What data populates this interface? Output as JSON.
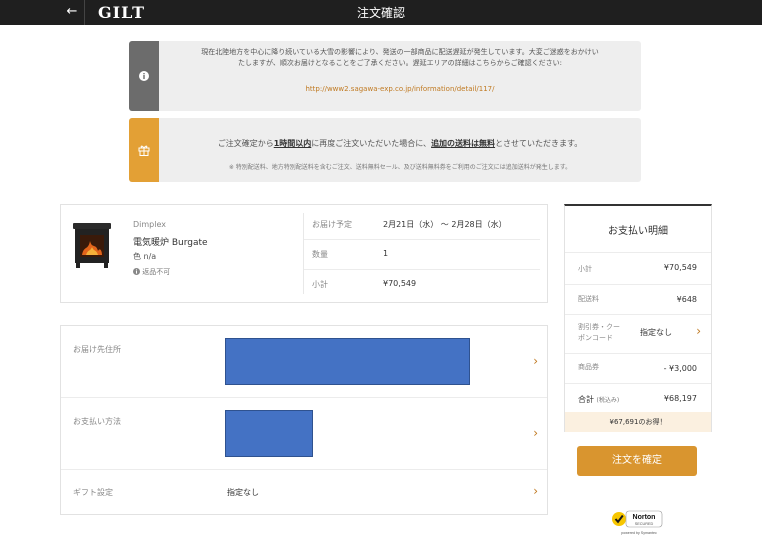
{
  "header": {
    "back_icon": "arrow-left-icon",
    "logo": "GILT",
    "title": "注文確認"
  },
  "notices": {
    "delivery": {
      "icon": "info-icon",
      "line1": "現在北陸地方を中心に降り続いている大雪の影響により、発送の一部商品に配送遅延が発生しています。大変ご迷惑をおかけい",
      "line2": "たしますが、順次お届けとなることをご了承ください。遅延エリアの詳細はこちらからご確認ください:",
      "link": "http://www2.sagawa-exp.co.jp/information/detail/117/"
    },
    "shipping": {
      "icon": "gift-icon",
      "text_a": "ご注文確定から",
      "text_b": "1時間以内",
      "text_c": "に再度ご注文いただいた場合に、",
      "text_d": "追加の送料は無料",
      "text_e": "とさせていただきます。",
      "note": "※ 特別配送料、地方特別配送料を含むご注文、送料無料セール、及び送料無料券をご利用のご注文には追加送料が発生します。"
    }
  },
  "product": {
    "brand": "Dimplex",
    "name": "電気暖炉 Burgate",
    "color": "色 n/a",
    "no_return_icon": "info-icon",
    "no_return": "返品不可",
    "delivery_label": "お届け予定",
    "delivery_value": "2月21日（水） ～ 2月28日（水）",
    "qty_label": "数量",
    "qty_value": "1",
    "subtotal_label": "小計",
    "subtotal_value": "¥70,549"
  },
  "info": {
    "address_label": "お届け先住所",
    "payment_label": "お支払い方法",
    "gift_label": "ギフト設定",
    "gift_value": "指定なし",
    "chevron": "›"
  },
  "summary": {
    "title": "お支払い明細",
    "subtotal_label": "小計",
    "subtotal_value": "¥70,549",
    "shipping_label": "配送料",
    "shipping_value": "¥648",
    "coupon_label_1": "割引券・クー",
    "coupon_label_2": "ポンコード",
    "coupon_value": "指定なし",
    "voucher_label": "商品券",
    "voucher_value": "- ¥3,000",
    "total_label": "合計",
    "total_tax": "(税込み)",
    "total_value": "¥68,197",
    "savings": "¥67,691のお得！"
  },
  "actions": {
    "confirm": "注文を確定"
  },
  "badge": {
    "brand": "Norton",
    "sub": "SECURED",
    "by": "powered by Symantec"
  },
  "colors": {
    "topbar": "#1f1f1f",
    "accent": "#d9952f",
    "notice_gray": "#6c6c6c",
    "notice_orange": "#e3a035",
    "redaction": "#4472c4"
  }
}
